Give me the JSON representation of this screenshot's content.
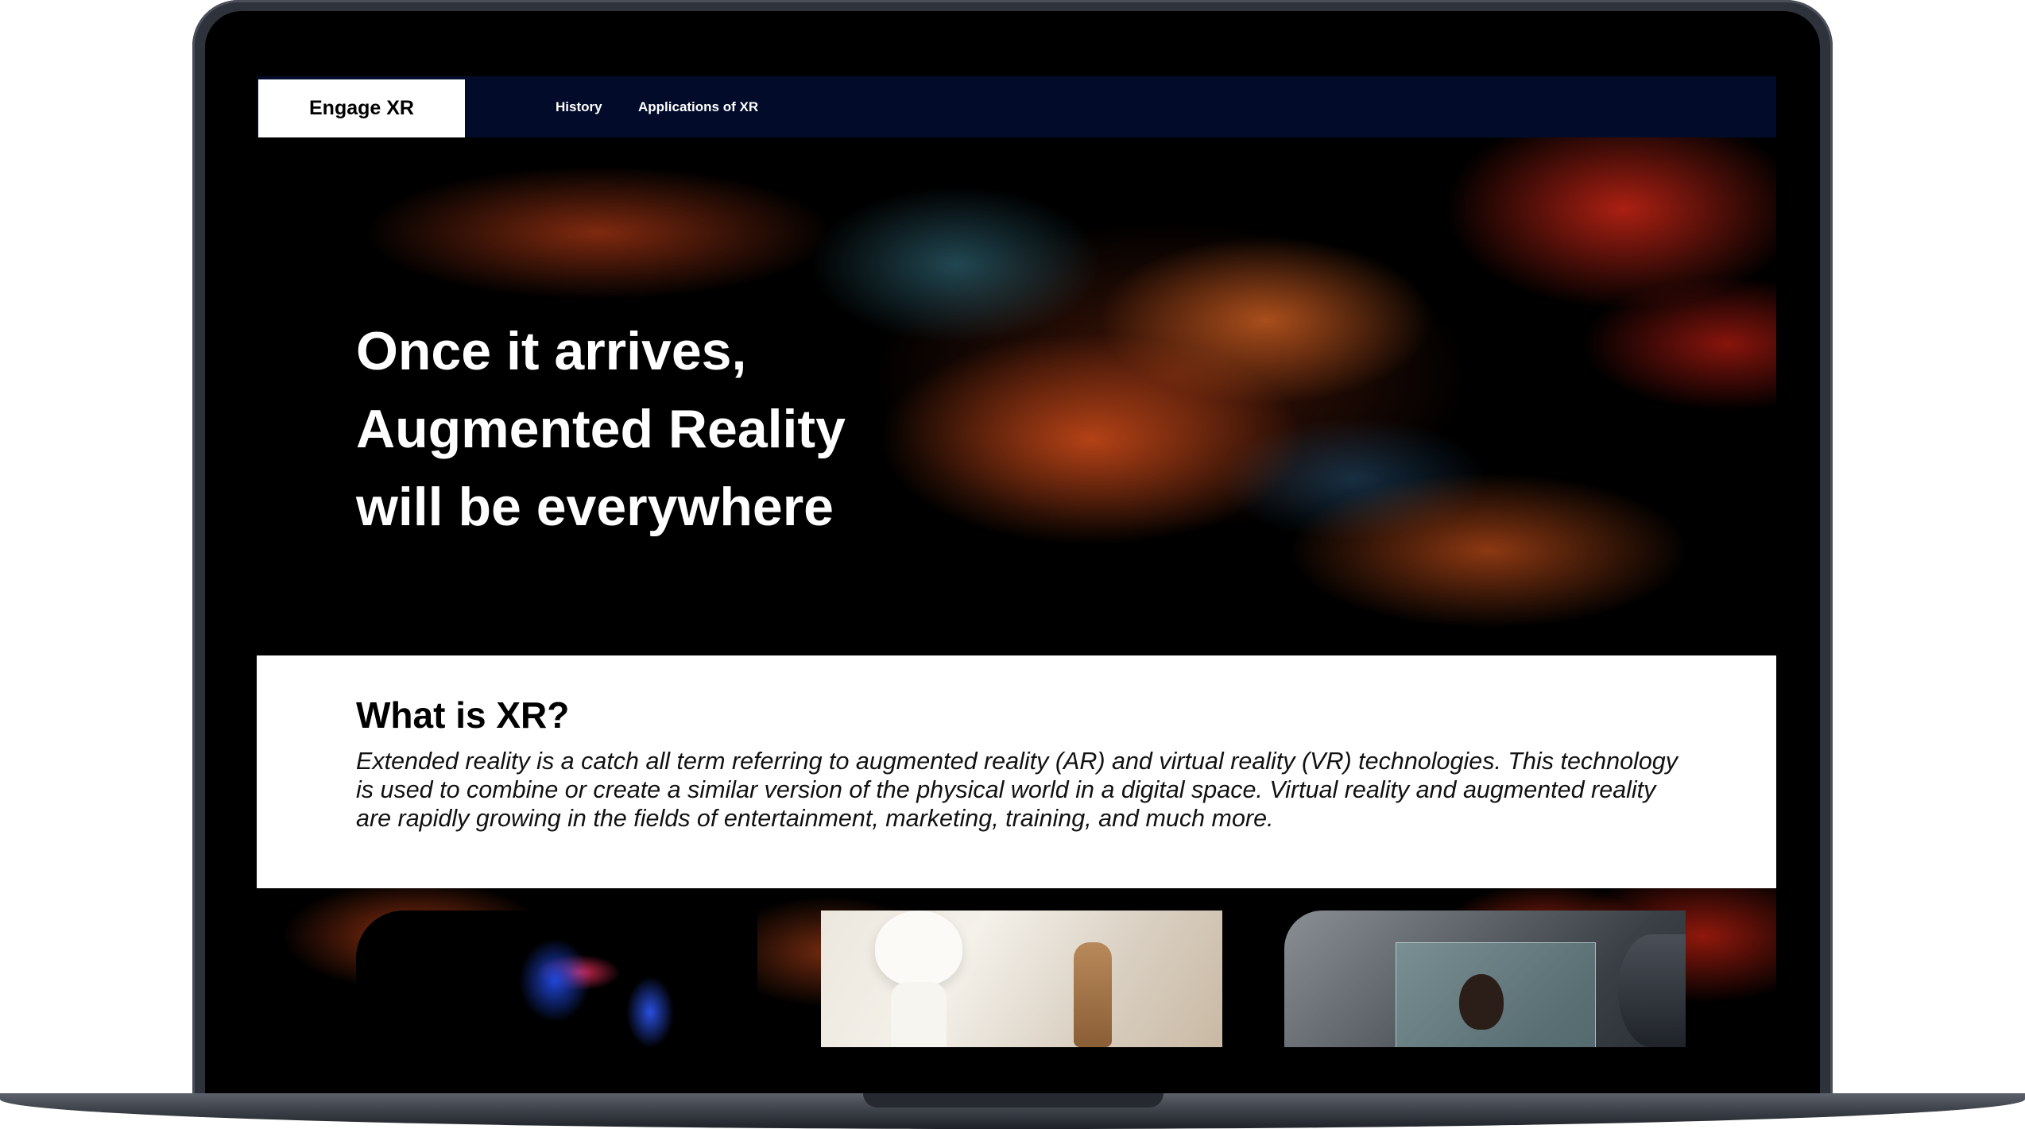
{
  "nav": {
    "brand": "Engage XR",
    "links": [
      "History",
      "Applications of XR"
    ]
  },
  "hero": {
    "title": "Once it arrives, Augmented Reality will be everywhere"
  },
  "about": {
    "title": "What is XR?",
    "body": "Extended reality is a catch all term referring to augmented reality (AR) and virtual reality (VR) technologies. This technology is used to combine or create a similar version of the physical world in a digital space. Virtual reality and augmented reality are rapidly growing in the fields of entertainment, marketing, training, and much more."
  },
  "colors": {
    "nav_background": "#030b2a",
    "brand_background": "#ffffff",
    "hero_background": "#000000"
  }
}
